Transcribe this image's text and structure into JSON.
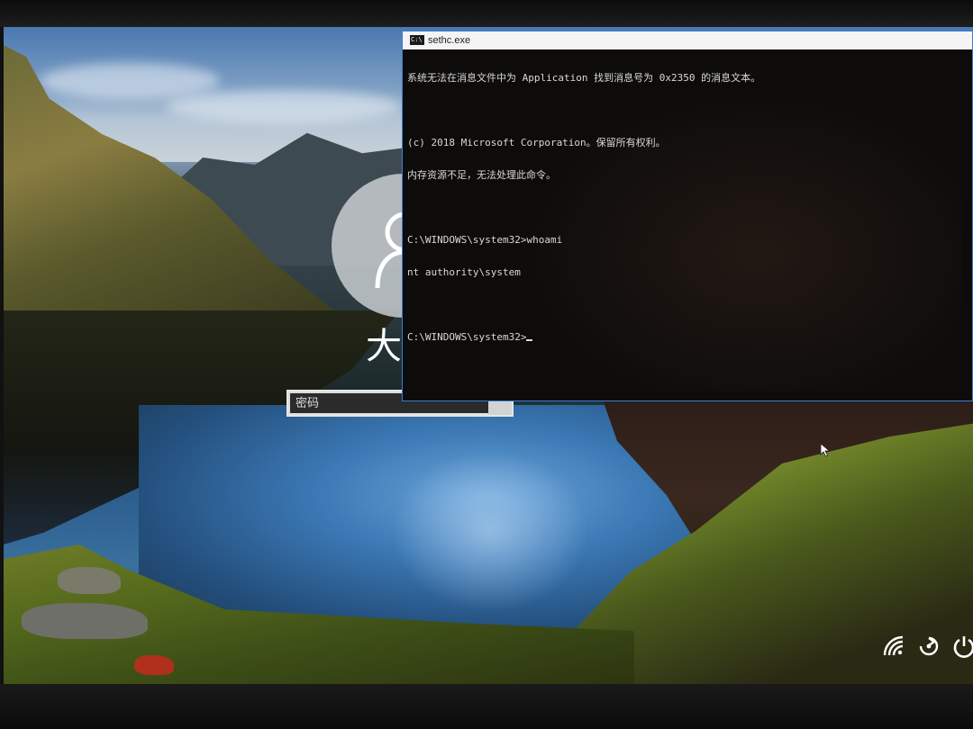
{
  "cmd_window": {
    "title": "sethc.exe",
    "icon_label": "C:\\",
    "lines": [
      "系统无法在消息文件中为 Application 找到消息号为 0x2350 的消息文本。",
      "",
      "(c) 2018 Microsoft Corporation。保留所有权利。",
      "内存资源不足，无法处理此命令。",
      "",
      "C:\\WINDOWS\\system32>whoami",
      "nt authority\\system",
      "",
      "C:\\WINDOWS\\system32>"
    ]
  },
  "lock_screen": {
    "username": "大",
    "password_placeholder": "密码"
  },
  "system_icons": [
    "network-icon",
    "ease-of-access-icon",
    "power-icon"
  ]
}
